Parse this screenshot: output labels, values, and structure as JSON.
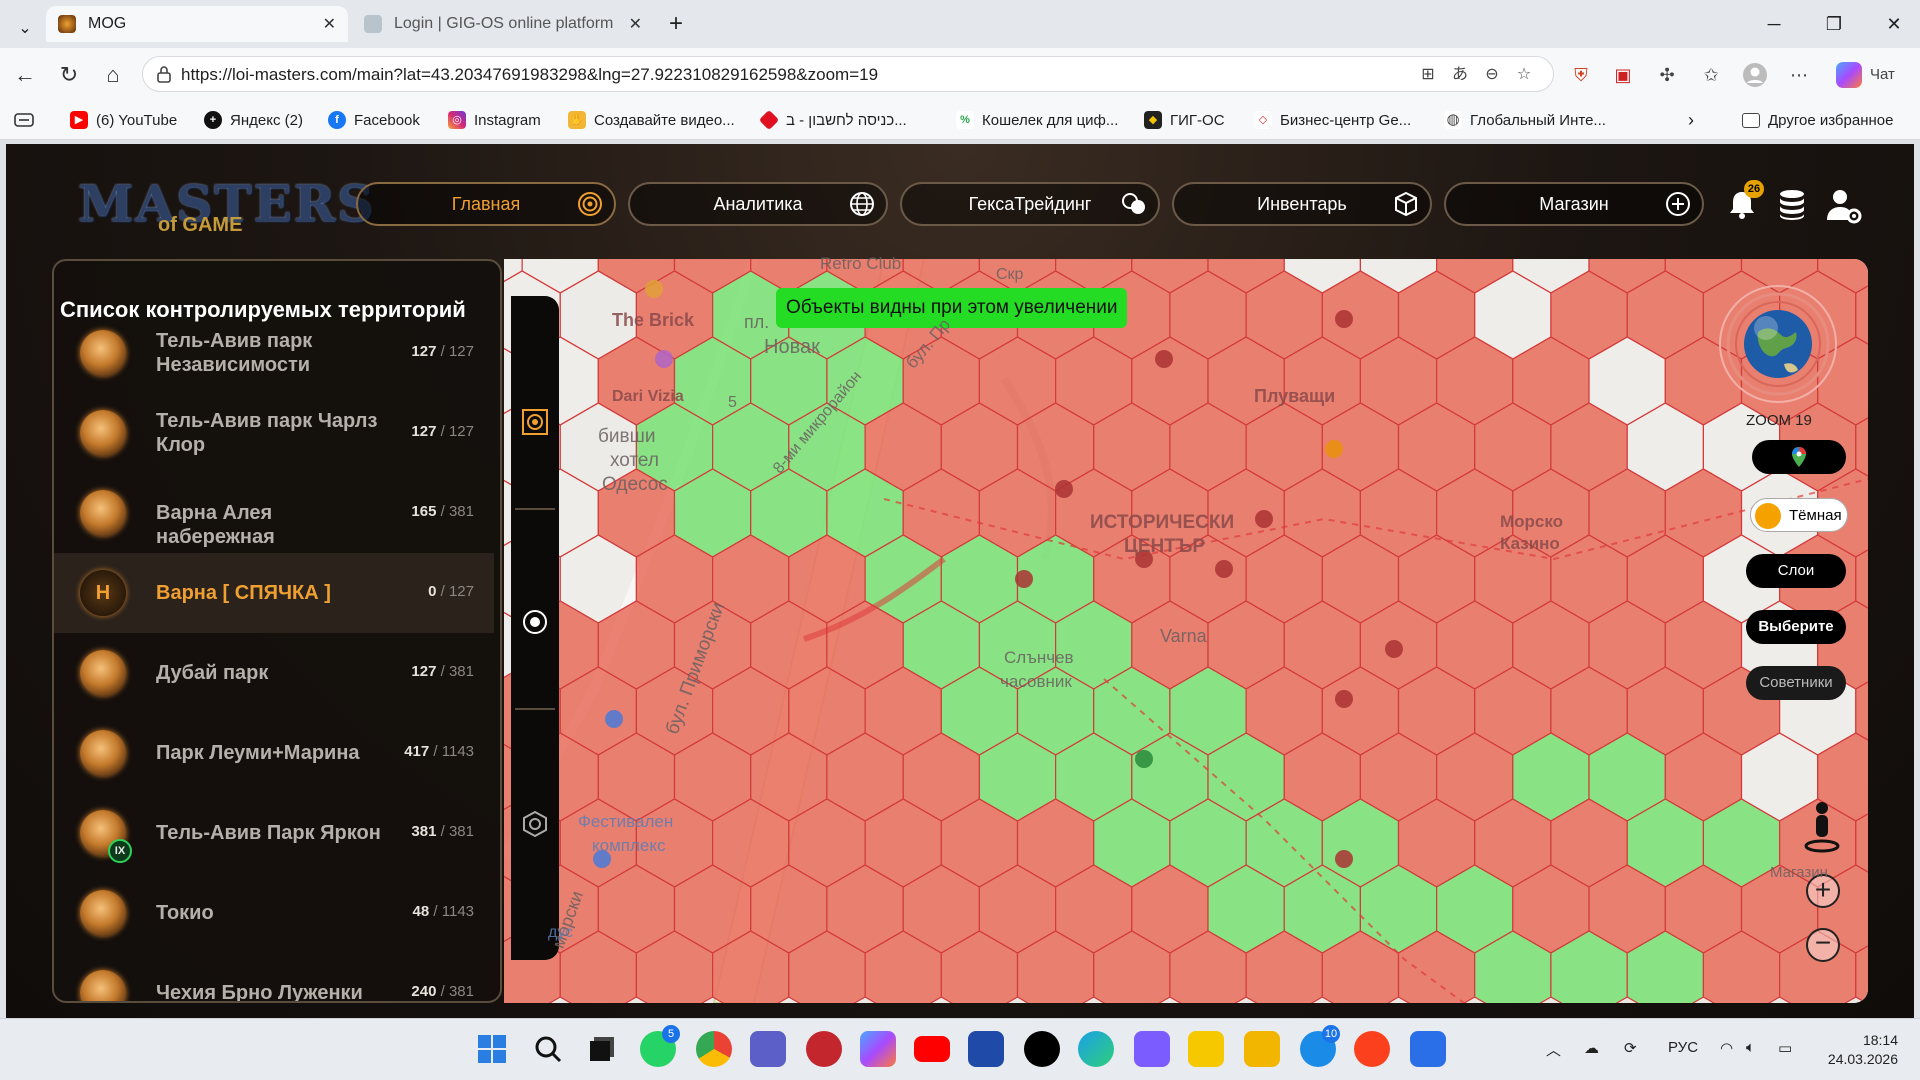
{
  "browser": {
    "tabs": [
      {
        "title": "MOG",
        "active": true
      },
      {
        "title": "Login | GIG-OS online platform",
        "active": false
      }
    ],
    "url": "https://loi-masters.com/main?lat=43.20347691983298&lng=27.922310829162598&zoom=19",
    "chat_label": "Чат",
    "bookmarks": [
      {
        "label": "(6) YouTube",
        "icon": "youtube-icon",
        "color": "#ff0000"
      },
      {
        "label": "Яндекс (2)",
        "icon": "plus-icon",
        "color": "#111111"
      },
      {
        "label": "Facebook",
        "icon": "facebook-icon",
        "color": "#1877f2"
      },
      {
        "label": "Instagram",
        "icon": "instagram-icon",
        "color": "#d62976"
      },
      {
        "label": "Создавайте видео...",
        "icon": "hand-icon",
        "color": "#f2b634"
      },
      {
        "label": "כניסה לחשבון - ב...",
        "icon": "diamond-icon",
        "color": "#e01020"
      },
      {
        "label": "Кошелек для циф...",
        "icon": "wallet-icon",
        "color": "#2aa84a"
      },
      {
        "label": "ГИГ-ОС",
        "icon": "gig-icon",
        "color": "#222222"
      },
      {
        "label": "Бизнес-центр Ge...",
        "icon": "gem-icon",
        "color": "#d33"
      },
      {
        "label": "Глобальный Инте...",
        "icon": "globe-icon",
        "color": "#444444"
      }
    ],
    "other_bookmarks": "Другое избранное"
  },
  "app": {
    "logo_main": "MASTERS",
    "logo_sub": "of GAME",
    "nav": [
      {
        "label": "Главная",
        "icon": "target-icon",
        "active": true
      },
      {
        "label": "Аналитика",
        "icon": "globe-icon",
        "active": false
      },
      {
        "label": "ГексаТрейдинг",
        "icon": "coins-icon",
        "active": false
      },
      {
        "label": "Инвентарь",
        "icon": "box-icon",
        "active": false
      },
      {
        "label": "Магазин",
        "icon": "plus-circle-icon",
        "active": false
      }
    ],
    "notifications_count": "26",
    "panel": {
      "title": "Список контролируемых территорий",
      "territories": [
        {
          "name": "Тель-Авив парк Независимости",
          "owned": "127",
          "total": "/ 127",
          "selected": false,
          "hibernating": false
        },
        {
          "name": "Тель-Авив парк Чарлз Клор",
          "owned": "127",
          "total": "/ 127",
          "selected": false,
          "hibernating": false
        },
        {
          "name": "Варна Алея набережная",
          "owned": "165",
          "total": "/ 381",
          "selected": false,
          "hibernating": false
        },
        {
          "name": "Варна [ СПЯЧКА ]",
          "owned": "0",
          "total": "/ 127",
          "selected": true,
          "hibernating": true,
          "coin_letter": "H"
        },
        {
          "name": "Дубай парк",
          "owned": "127",
          "total": "/ 381",
          "selected": false,
          "hibernating": false
        },
        {
          "name": "Парк Леуми+Марина",
          "owned": "417",
          "total": "/ 1143",
          "selected": false,
          "hibernating": false
        },
        {
          "name": "Тель-Авив Парк Яркон",
          "owned": "381",
          "total": "/ 381",
          "selected": false,
          "hibernating": false,
          "badge": "IX"
        },
        {
          "name": "Токио",
          "owned": "48",
          "total": "/ 1143",
          "selected": false,
          "hibernating": false
        },
        {
          "name": "Чехия Брно Луженки",
          "owned": "240",
          "total": "/ 381",
          "selected": false,
          "hibernating": false
        }
      ]
    },
    "map": {
      "toast": "Объекты видны при этом увеличении",
      "zoom_label": "ZOOM 19",
      "theme_label": "Тёмная",
      "layers_label": "Слои",
      "select_label": "Выберите",
      "advisors_label": "Советники",
      "labels": {
        "retro": "Retro Club",
        "brick": "The Brick",
        "pl": "пл.",
        "novak": "Новак",
        "dari": "Dari Vizia",
        "five": "5",
        "hotel1": "бивши",
        "hotel2": "хотел",
        "hotel3": "Одесос",
        "mikro": "8-ми микрорайон",
        "blvd1": "бул. Пр",
        "skr": "Скр",
        "pluv": "Плуващи",
        "hist1": "ИСТОРИЧЕСКИ",
        "hist2": "ЦЕНТЪР",
        "morsko1": "Морско",
        "morsko2": "Казино",
        "varna": "Varna",
        "sun1": "Слънчев",
        "sun2": "часовник",
        "primor": "бул. Приморски",
        "fest1": "Фестивален",
        "fest2": "комплекс",
        "morski": "морски",
        "dus": "дус",
        "mag": "Магазин"
      },
      "colors": {
        "owned": "#7ee27a",
        "enemy": "#e8705f",
        "free": "#f2f1ef"
      }
    }
  },
  "taskbar": {
    "whatsapp_badge": "5",
    "store_badge": "10",
    "lang": "РУС",
    "time": "18:14",
    "date": "24.03.2026"
  }
}
